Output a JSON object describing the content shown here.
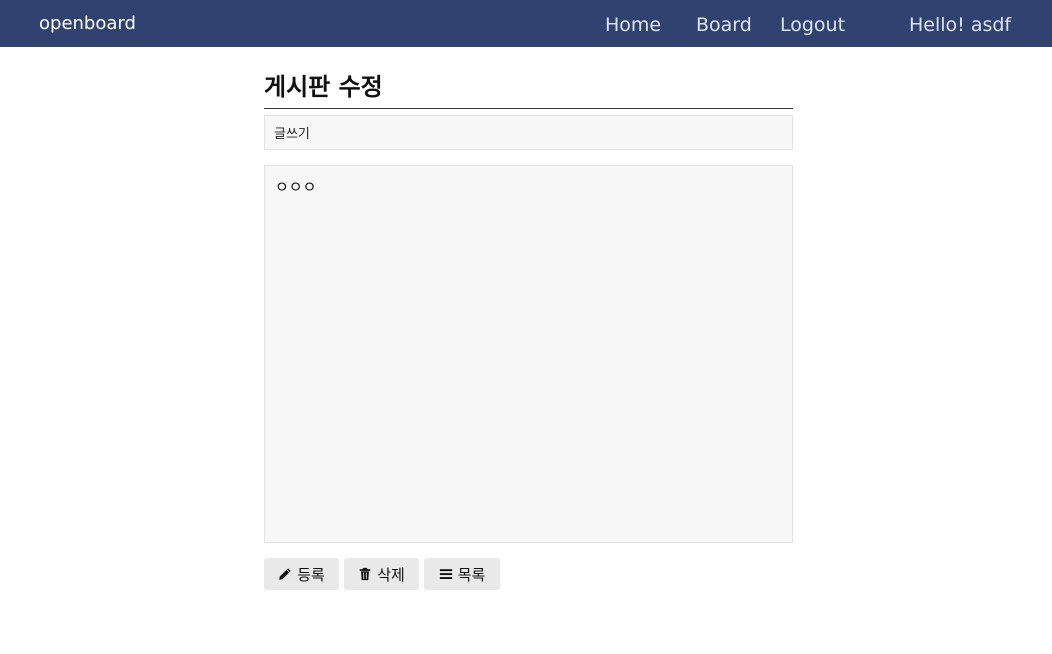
{
  "navbar": {
    "brand": "openboard",
    "links": {
      "home": "Home",
      "board": "Board",
      "logout": "Logout"
    },
    "greeting": "Hello! asdf",
    "background": "#2f4270"
  },
  "page": {
    "title": "게시판 수정"
  },
  "form": {
    "title_value": "글쓰기",
    "content_value": "ㅇㅇㅇ"
  },
  "buttons": {
    "save": {
      "label": "등록",
      "icon": "pencil-icon"
    },
    "delete": {
      "label": "삭제",
      "icon": "trash-icon"
    },
    "list": {
      "label": "목록",
      "icon": "list-icon"
    }
  }
}
